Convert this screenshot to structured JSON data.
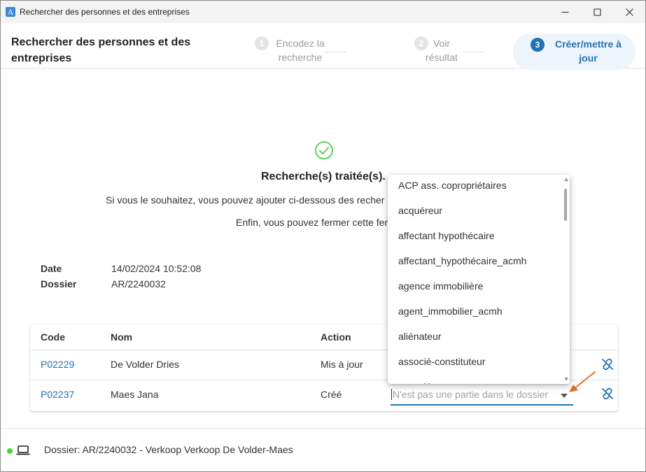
{
  "window": {
    "title": "Rechercher des personnes et des entreprises",
    "app_icon_letter": "A"
  },
  "header": {
    "title": "Rechercher des personnes et des entreprises",
    "steps": [
      {
        "number": "1",
        "label": "Encodez la recherche"
      },
      {
        "number": "2",
        "label": "Voir résultat"
      },
      {
        "number": "3",
        "label": "Créer/mettre à jour"
      }
    ],
    "active_color": "#1f73b5"
  },
  "content": {
    "result_title": "Recherche(s) traitée(s).",
    "info_line1": "Si vous le souhaitez, vous pouvez ajouter ci-dessous des recher",
    "info_line2": "Enfin, vous pouvez fermer cette fen",
    "date_label": "Date",
    "date_value": "14/02/2024 10:52:08",
    "dossier_label": "Dossier",
    "dossier_value": "AR/2240032"
  },
  "table": {
    "headers": {
      "code": "Code",
      "nom": "Nom",
      "action": "Action"
    },
    "rows": [
      {
        "code": "P02229",
        "nom": "De Volder Dries",
        "action": "Mis à jour"
      },
      {
        "code": "P02237",
        "nom": "Maes Jana",
        "action": "Créé",
        "select_placeholder": "N'est pas une partie dans le dossier"
      }
    ],
    "link_color": "#1f73b5"
  },
  "dropdown": {
    "options": [
      "ACP ass. copropriétaires",
      "acquéreur",
      "affectant hypothécaire",
      "affectant_hypothécaire_acmh",
      "agence immobilière",
      "agent_immobilier_acmh",
      "aliénateur",
      "associé-constituteur",
      "associé"
    ]
  },
  "footer": {
    "status_text": "Dossier: AR/2240032 - Verkoop Verkoop De Volder-Maes",
    "status_color": "#3ddc2e"
  },
  "annotation": {
    "arrow_color": "#e07020"
  }
}
